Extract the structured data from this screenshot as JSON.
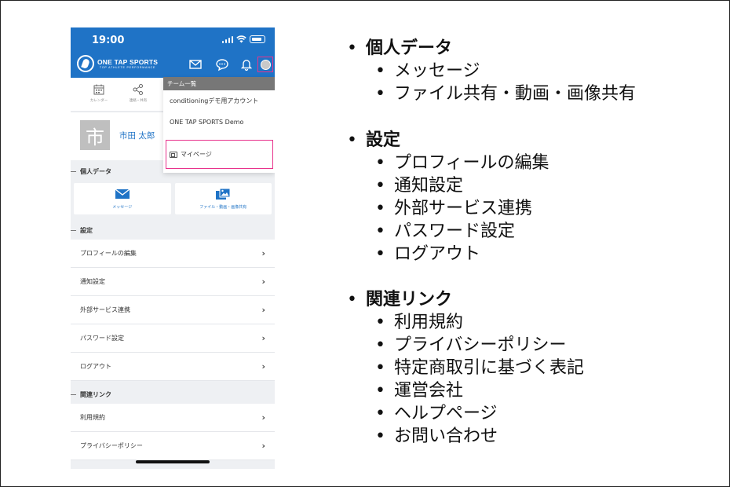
{
  "phone": {
    "status": {
      "time": "19:00"
    },
    "header": {
      "logo_title": "ONE TAP SPORTS",
      "logo_sub": "TOP ATHLETE PERFORMANCE",
      "icons": [
        "mail-icon",
        "chat-icon",
        "bell-icon",
        "avatar-icon"
      ]
    },
    "quick_nav": [
      {
        "label": "カレンダー",
        "icon": "calendar-icon"
      },
      {
        "label": "連絡・共有",
        "icon": "share-icon"
      }
    ],
    "profile": {
      "avatar_char": "市",
      "name": "市田 太郎"
    },
    "sections": {
      "personal": "個人データ",
      "settings": "設定",
      "links": "関連リンク"
    },
    "personal_tiles": [
      {
        "label": "メッセージ",
        "icon": "envelope-icon"
      },
      {
        "label": "ファイル・動画・画像共有",
        "icon": "media-icon"
      }
    ],
    "settings_items": [
      "プロフィールの編集",
      "通知設定",
      "外部サービス連携",
      "パスワード設定",
      "ログアウト"
    ],
    "link_items": [
      "利用規約",
      "プライバシーポリシー"
    ],
    "dropdown": {
      "header": "チーム一覧",
      "teams": [
        "conditioningデモ用アカウント",
        "ONE TAP SPORTS Demo"
      ],
      "mypage": "マイページ"
    }
  },
  "outline": [
    {
      "heading": "個人データ",
      "items": [
        "メッセージ",
        "ファイル共有・動画・画像共有"
      ]
    },
    {
      "heading": "設定",
      "items": [
        "プロフィールの編集",
        "通知設定",
        "外部サービス連携",
        "パスワード設定",
        "ログアウト"
      ]
    },
    {
      "heading": "関連リンク",
      "items": [
        "利用規約",
        "プライバシーポリシー",
        "特定商取引に基づく表記",
        "運営会社",
        "ヘルプページ",
        "お問い合わせ"
      ]
    }
  ],
  "colors": {
    "brand_blue": "#1f73c6",
    "highlight_pink": "#e8338c",
    "background": "#eef0f3"
  }
}
